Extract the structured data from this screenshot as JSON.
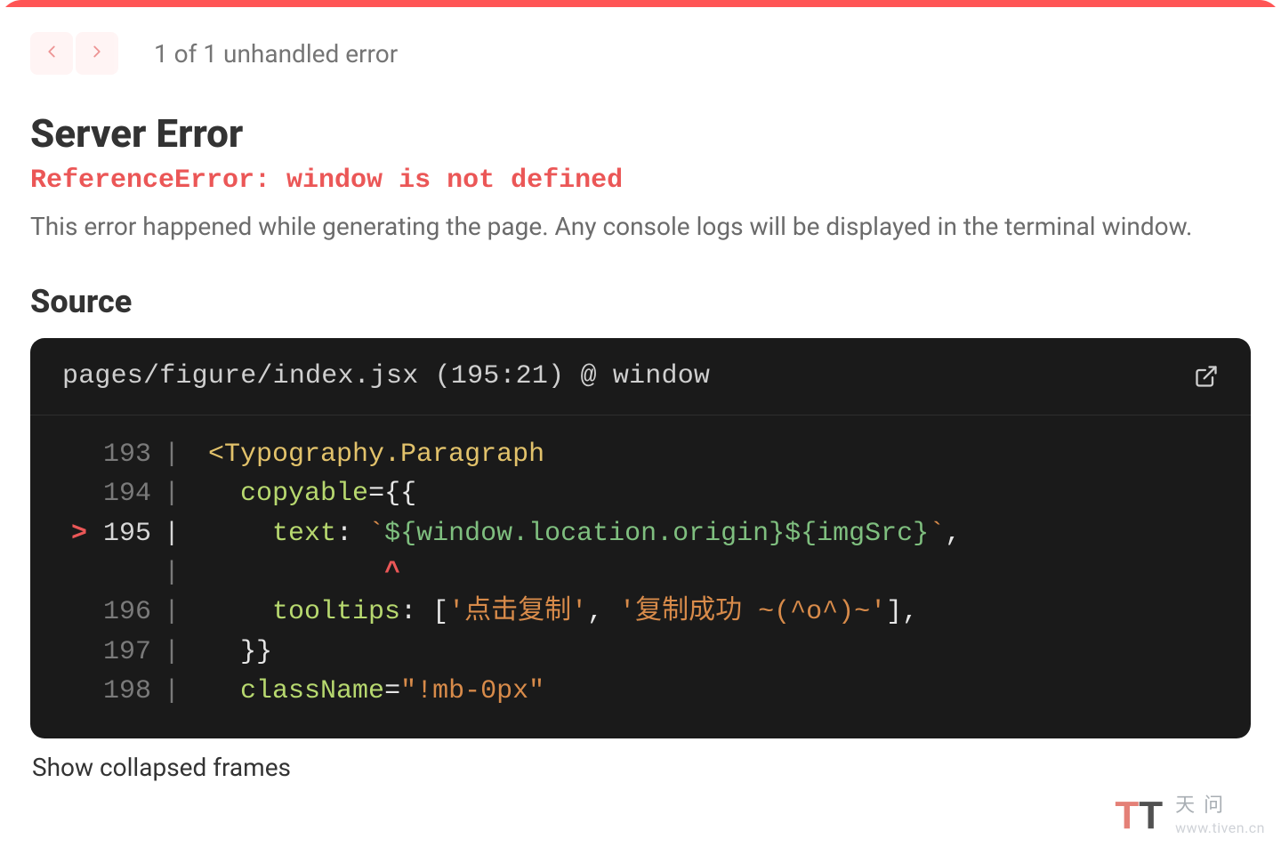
{
  "nav": {
    "prev_title": "Previous error",
    "next_title": "Next error",
    "counter": "1 of 1 unhandled error"
  },
  "error": {
    "section_title": "Server Error",
    "message": "ReferenceError: window is not defined",
    "description": "This error happened while generating the page. Any console logs will be displayed in the terminal window."
  },
  "source": {
    "heading": "Source",
    "file": "pages/figure/index.jsx",
    "loc": "(195:21)",
    "at": "@",
    "symbol": "window",
    "open_title": "Open in editor",
    "lines": [
      {
        "n": "193",
        "mark": "",
        "tokens": [
          {
            "cls": "tok-tag",
            "t": "<Typography.Paragraph"
          }
        ]
      },
      {
        "n": "194",
        "mark": "",
        "tokens": [
          {
            "cls": "tok-text",
            "t": "  "
          },
          {
            "cls": "tok-attr",
            "t": "copyable"
          },
          {
            "cls": "tok-punc",
            "t": "="
          },
          {
            "cls": "tok-brace",
            "t": "{{"
          }
        ]
      },
      {
        "n": "195",
        "mark": ">",
        "hl": true,
        "tokens": [
          {
            "cls": "tok-text",
            "t": "    "
          },
          {
            "cls": "tok-attr",
            "t": "text"
          },
          {
            "cls": "tok-punc",
            "t": ": "
          },
          {
            "cls": "tok-str",
            "t": "`"
          },
          {
            "cls": "tok-tmpl",
            "t": "${window.location.origin}${imgSrc}"
          },
          {
            "cls": "tok-str",
            "t": "`"
          },
          {
            "cls": "tok-punc",
            "t": ","
          }
        ]
      },
      {
        "n": "",
        "mark": "",
        "tokens": [
          {
            "cls": "tok-text",
            "t": "           "
          },
          {
            "cls": "tok-caret",
            "t": "^"
          }
        ]
      },
      {
        "n": "196",
        "mark": "",
        "tokens": [
          {
            "cls": "tok-text",
            "t": "    "
          },
          {
            "cls": "tok-attr",
            "t": "tooltips"
          },
          {
            "cls": "tok-punc",
            "t": ": ["
          },
          {
            "cls": "tok-str",
            "t": "'点击复制'"
          },
          {
            "cls": "tok-punc",
            "t": ", "
          },
          {
            "cls": "tok-str",
            "t": "'复制成功 ~(^o^)~'"
          },
          {
            "cls": "tok-punc",
            "t": "],"
          }
        ]
      },
      {
        "n": "197",
        "mark": "",
        "tokens": [
          {
            "cls": "tok-text",
            "t": "  "
          },
          {
            "cls": "tok-brace",
            "t": "}}"
          }
        ]
      },
      {
        "n": "198",
        "mark": "",
        "tokens": [
          {
            "cls": "tok-text",
            "t": "  "
          },
          {
            "cls": "tok-attr",
            "t": "className"
          },
          {
            "cls": "tok-punc",
            "t": "="
          },
          {
            "cls": "tok-str",
            "t": "\"!mb-0px\""
          }
        ]
      }
    ],
    "show_frames": "Show collapsed frames"
  },
  "watermark": {
    "glyph1": "T",
    "glyph2": "T",
    "line1": "天问",
    "line2": "www.tiven.cn"
  }
}
